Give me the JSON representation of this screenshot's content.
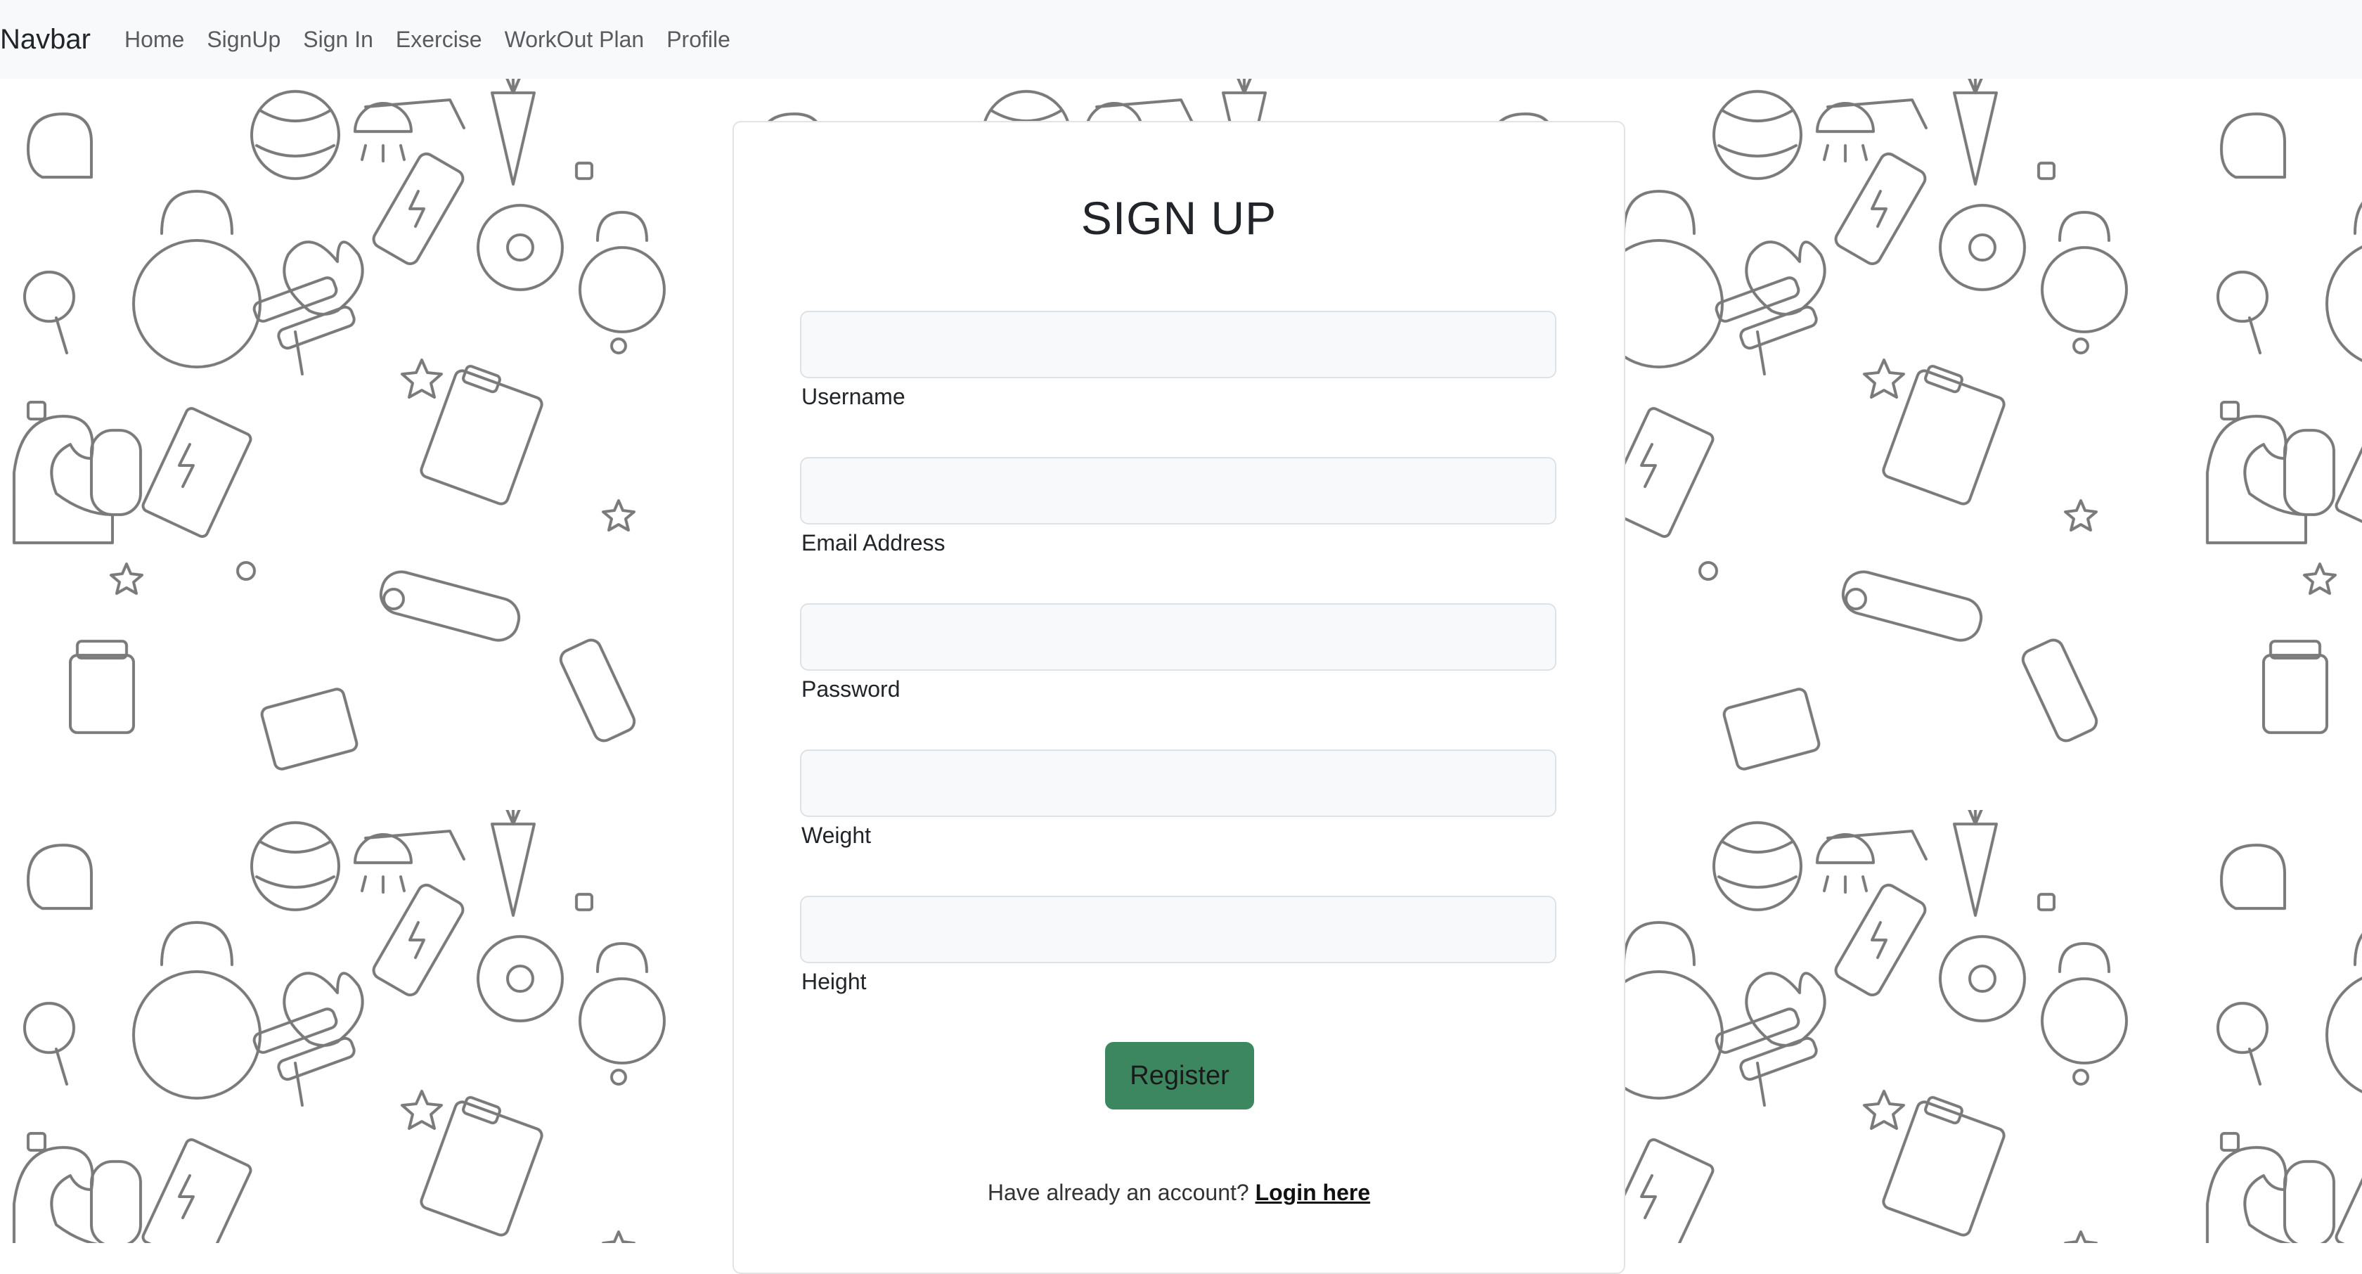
{
  "navbar": {
    "brand": "Navbar",
    "links": [
      "Home",
      "SignUp",
      "Sign In",
      "Exercise",
      "WorkOut Plan",
      "Profile"
    ]
  },
  "form": {
    "title": "SIGN UP",
    "fields": [
      {
        "label": "Username",
        "value": ""
      },
      {
        "label": "Email Address",
        "value": ""
      },
      {
        "label": "Password",
        "value": ""
      },
      {
        "label": "Weight",
        "value": ""
      },
      {
        "label": "Height",
        "value": ""
      }
    ],
    "submit_label": "Register",
    "login_prompt": "Have already an account?",
    "login_link": "Login here"
  },
  "colors": {
    "navbar_bg": "#f8f9fa",
    "register_button": "#3d8760",
    "pattern_stroke": "#7a7a7a"
  },
  "background": {
    "pattern": "fitness-doodle-icons",
    "icons": [
      "kettlebell-icon",
      "dumbbell-icon",
      "carrot-icon",
      "weight-plate-icon",
      "fitness-ball-icon",
      "bicep-icon",
      "clipboard-icon",
      "battery-icon",
      "shower-icon",
      "boxing-glove-icon",
      "star-icon"
    ]
  }
}
